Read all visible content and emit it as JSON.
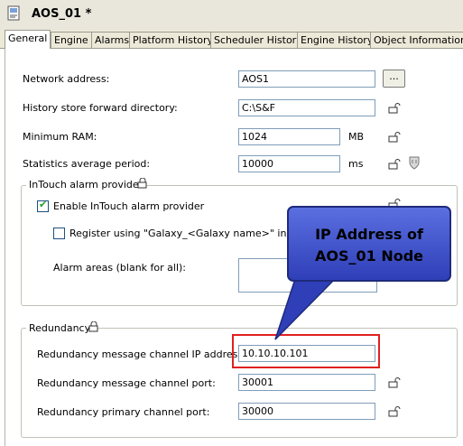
{
  "window": {
    "title": "AOS_01 *",
    "icon": "document-icon"
  },
  "tabs": [
    {
      "label": "General",
      "active": true
    },
    {
      "label": "Engine"
    },
    {
      "label": "Alarms"
    },
    {
      "label": "Platform History"
    },
    {
      "label": "Scheduler History"
    },
    {
      "label": "Engine History"
    },
    {
      "label": "Object Information"
    }
  ],
  "general": {
    "network_address": {
      "label": "Network address:",
      "value": "AOS1",
      "browse_label": "..."
    },
    "history_dir": {
      "label": "History store forward directory:",
      "value": "C:\\S&F"
    },
    "min_ram": {
      "label": "Minimum RAM:",
      "value": "1024",
      "unit": "MB"
    },
    "stats_period": {
      "label": "Statistics average period:",
      "value": "10000",
      "unit": "ms"
    }
  },
  "intouch_group": {
    "title": "InTouch alarm provider",
    "enable_label": "Enable InTouch alarm provider",
    "enable_checked": true,
    "register_label": "Register using \"Galaxy_<Galaxy name>\" instead of",
    "register_checked": false,
    "alarm_areas_label": "Alarm areas (blank for all):",
    "alarm_areas_value": ""
  },
  "redundancy": {
    "title": "Redundancy",
    "ip": {
      "label": "Redundancy message channel IP address:",
      "value": "10.10.10.101"
    },
    "msg_port": {
      "label": "Redundancy message channel port:",
      "value": "30001"
    },
    "primary_port": {
      "label": "Redundancy primary channel port:",
      "value": "30000"
    }
  },
  "annotation": {
    "text": "IP Address of\nAOS_01 Node",
    "fill": "#3f51d0",
    "highlight_color": "#e02020"
  }
}
